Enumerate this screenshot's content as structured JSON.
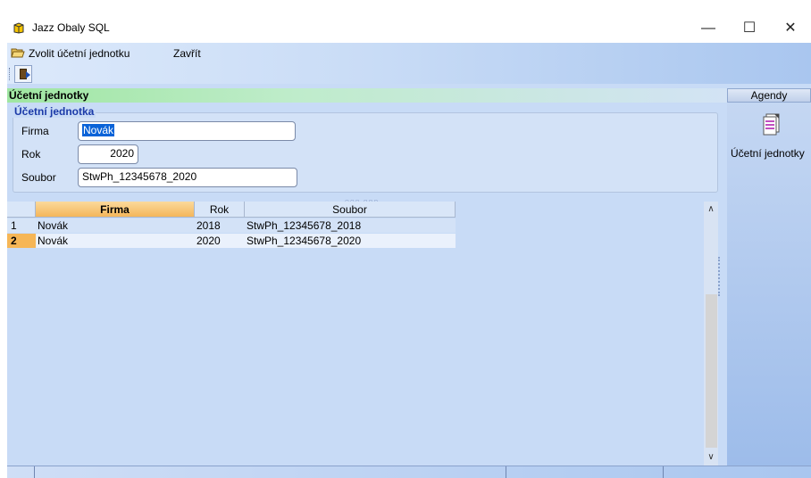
{
  "window": {
    "title": "Jazz Obaly SQL",
    "minimize_glyph": "—",
    "maximize_glyph": "☐",
    "close_glyph": "✕"
  },
  "menu": {
    "items": [
      {
        "label": "Zvolit účetní jednotku",
        "icon": "folder-open-icon"
      },
      {
        "label": "Zavřít"
      }
    ]
  },
  "toolbar": {
    "buttons": [
      {
        "icon": "exit-door-icon"
      }
    ]
  },
  "section": {
    "title": "Účetní jednotky"
  },
  "form": {
    "group_title": "Účetní jednotka",
    "firma_label": "Firma",
    "firma_value": "Novák",
    "rok_label": "Rok",
    "rok_value": "2020",
    "soubor_label": "Soubor",
    "soubor_value": "StwPh_12345678_2020"
  },
  "grid": {
    "columns": [
      "Firma",
      "Rok",
      "Soubor"
    ],
    "sorted_column": "Firma",
    "drag_handle": "○○○ ○○○",
    "rows": [
      {
        "num": "1",
        "firma": "Novák",
        "rok": "2018",
        "soubor": "StwPh_12345678_2018"
      },
      {
        "num": "2",
        "firma": "Novák",
        "rok": "2020",
        "soubor": "StwPh_12345678_2020",
        "selected": true
      }
    ],
    "scroll_up": "∧",
    "scroll_down": "∨"
  },
  "agendy": {
    "header": "Agendy",
    "items": [
      {
        "label": "Účetní jednotky",
        "icon": "documents-icon"
      }
    ]
  },
  "colors": {
    "selection_orange": "#f6b656",
    "group_title_blue": "#1b3aa8",
    "section_green": "#9fe6a1"
  }
}
